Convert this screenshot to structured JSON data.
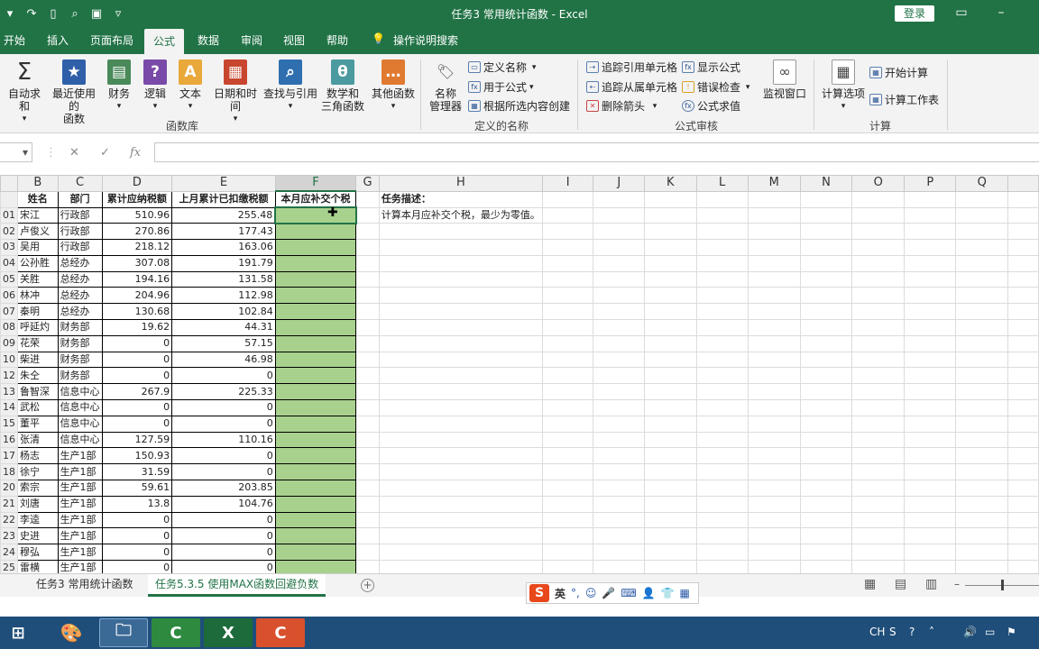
{
  "window": {
    "title": "任务3 常用统计函数 - Excel",
    "login": "登录"
  },
  "ribbon_tabs": [
    "开始",
    "插入",
    "页面布局",
    "公式",
    "数据",
    "审阅",
    "视图",
    "帮助"
  ],
  "search_label": "操作说明搜索",
  "ribbon": {
    "function_library": {
      "buttons": [
        "自动求和",
        "最近使用的\n函数",
        "财务",
        "逻辑",
        "文本",
        "日期和时间",
        "查找与引用",
        "数学和\n三角函数",
        "其他函数"
      ],
      "label": "函数库"
    },
    "defined_names": {
      "name_manager": "名称\n管理器",
      "items": [
        "定义名称",
        "用于公式",
        "根据所选内容创建"
      ],
      "label": "定义的名称"
    },
    "formula_auditing": {
      "items": [
        "追踪引用单元格",
        "追踪从属单元格",
        "删除箭头",
        "显示公式",
        "错误检查",
        "公式求值"
      ],
      "watch": "监视窗口",
      "label": "公式审核"
    },
    "calculation": {
      "options": "计算选项",
      "items": [
        "开始计算",
        "计算工作表"
      ],
      "label": "计算"
    }
  },
  "formula_bar": {
    "fx": "fx"
  },
  "columns": [
    "",
    "B",
    "C",
    "D",
    "E",
    "F",
    "G",
    "H",
    "I",
    "J",
    "K",
    "L",
    "M",
    "N",
    "O",
    "P",
    "Q"
  ],
  "header_row": [
    "",
    "姓名",
    "部门",
    "累计应纳税额",
    "上月累计已扣缴税额",
    "本月应补交个税"
  ],
  "task": {
    "title": "任务描述：",
    "desc": "计算本月应补交个税，最少为零值。"
  },
  "rows": [
    [
      "01",
      "宋江",
      "行政部",
      "510.96",
      "255.48"
    ],
    [
      "02",
      "卢俊义",
      "行政部",
      "270.86",
      "177.43"
    ],
    [
      "03",
      "吴用",
      "行政部",
      "218.12",
      "163.06"
    ],
    [
      "04",
      "公孙胜",
      "总经办",
      "307.08",
      "191.79"
    ],
    [
      "05",
      "关胜",
      "总经办",
      "194.16",
      "131.58"
    ],
    [
      "06",
      "林冲",
      "总经办",
      "204.96",
      "112.98"
    ],
    [
      "07",
      "秦明",
      "总经办",
      "130.68",
      "102.84"
    ],
    [
      "08",
      "呼延灼",
      "财务部",
      "19.62",
      "44.31"
    ],
    [
      "09",
      "花荣",
      "财务部",
      "0",
      "57.15"
    ],
    [
      "10",
      "柴进",
      "财务部",
      "0",
      "46.98"
    ],
    [
      "12",
      "朱仝",
      "财务部",
      "0",
      "0"
    ],
    [
      "13",
      "鲁智深",
      "信息中心",
      "267.9",
      "225.33"
    ],
    [
      "14",
      "武松",
      "信息中心",
      "0",
      "0"
    ],
    [
      "15",
      "董平",
      "信息中心",
      "0",
      "0"
    ],
    [
      "16",
      "张清",
      "信息中心",
      "127.59",
      "110.16"
    ],
    [
      "17",
      "杨志",
      "生产1部",
      "150.93",
      "0"
    ],
    [
      "18",
      "徐宁",
      "生产1部",
      "31.59",
      "0"
    ],
    [
      "20",
      "索宗",
      "生产1部",
      "59.61",
      "203.85"
    ],
    [
      "21",
      "刘唐",
      "生产1部",
      "13.8",
      "104.76"
    ],
    [
      "22",
      "李逵",
      "生产1部",
      "0",
      "0"
    ],
    [
      "23",
      "史进",
      "生产1部",
      "0",
      "0"
    ],
    [
      "24",
      "穆弘",
      "生产1部",
      "0",
      "0"
    ],
    [
      "25",
      "雷横",
      "生产1部",
      "0",
      "0"
    ]
  ],
  "sheets": [
    "任务3 常用统计函数",
    "任务5.3.5 使用MAX函数回避负数"
  ],
  "ime": {
    "label": "英"
  },
  "tray": {
    "lang": "CH"
  },
  "colors": {
    "excel_green": "#217346",
    "fill_green": "#a9d18e"
  }
}
